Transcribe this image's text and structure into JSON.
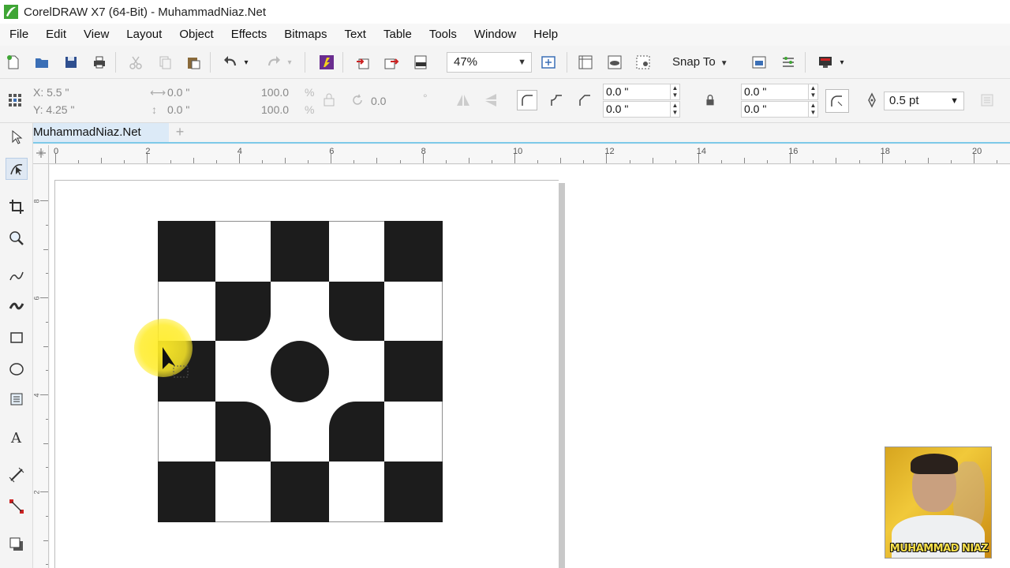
{
  "window": {
    "title": "CorelDRAW X7 (64-Bit) - MuhammadNiaz.Net"
  },
  "menu": [
    "File",
    "Edit",
    "View",
    "Layout",
    "Object",
    "Effects",
    "Bitmaps",
    "Text",
    "Table",
    "Tools",
    "Window",
    "Help"
  ],
  "toolbar": {
    "zoom": "47%",
    "snap_to": "Snap To"
  },
  "properties": {
    "x": "X: 5.5 \"",
    "y": "Y: 4.25 \"",
    "width": "0.0 \"",
    "height": "0.0 \"",
    "scale_x": "100.0",
    "scale_y": "100.0",
    "pct": "%",
    "rotation": "0.0",
    "degree": "°",
    "corner_1": "0.0 \"",
    "corner_2": "0.0 \"",
    "corner_3": "0.0 \"",
    "corner_4": "0.0 \"",
    "outline_width": "0.5 pt"
  },
  "document": {
    "tab_label": "MuhammadNiaz.Net",
    "add_tab": "+"
  },
  "ruler": {
    "h_labels": [
      "0",
      "2",
      "4",
      "6",
      "8",
      "10",
      "12",
      "14",
      "16",
      "18",
      "20"
    ],
    "v_labels": [
      "8",
      "6",
      "4",
      "2"
    ]
  },
  "webcam": {
    "label": "MUHAMMAD NIAZ"
  },
  "colors": {
    "accent": "#7ec9e8",
    "artwork": "#1c1c1c",
    "highlight": "#ffec28"
  }
}
